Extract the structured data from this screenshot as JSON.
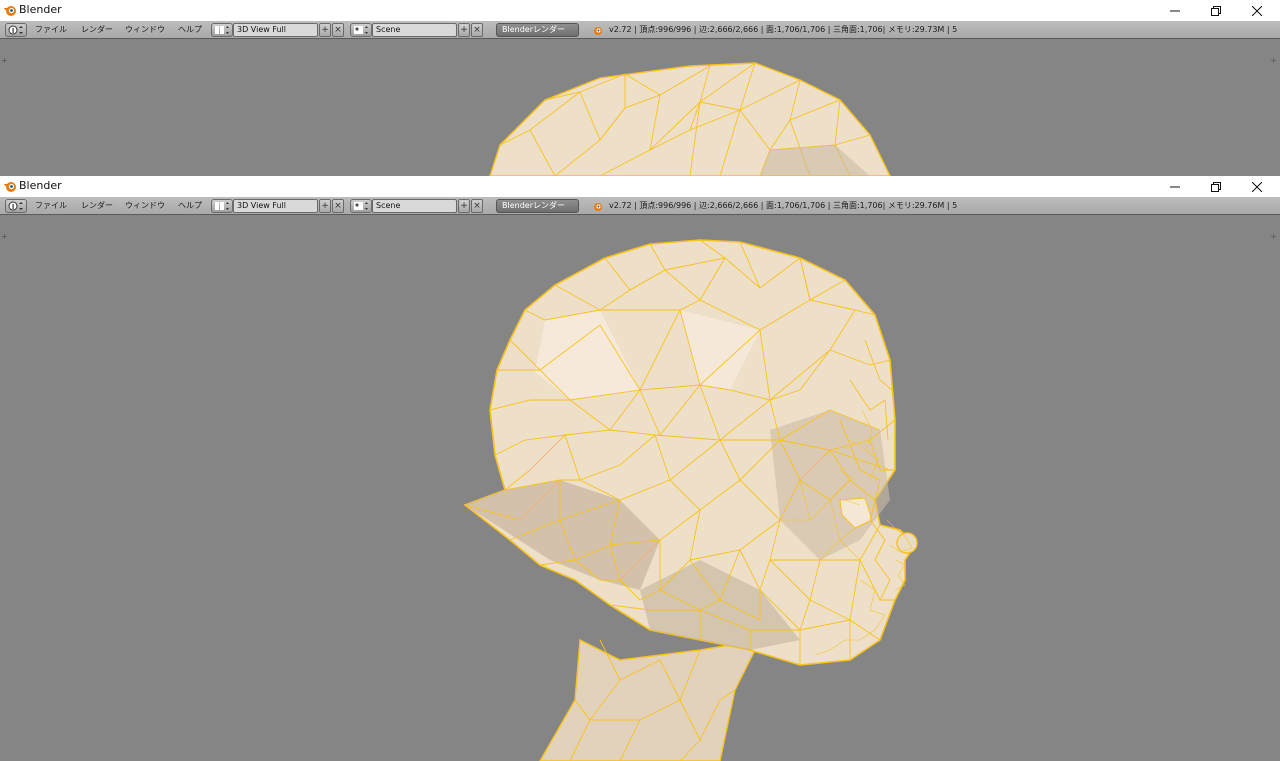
{
  "app": {
    "title": "Blender"
  },
  "menus": [
    "ファイル",
    "レンダー",
    "ウィンドウ",
    "ヘルプ"
  ],
  "screen_layout": {
    "value": "3D View Full"
  },
  "scene": {
    "value": "Scene"
  },
  "render_engine": {
    "value": "Blenderレンダー"
  },
  "windows": [
    {
      "stats": "v2.72 | 頂点:996/996 | 辺:2,666/2,666 | 面:1,706/1,706 | 三角面:1,706| メモリ:29.73M | 5"
    },
    {
      "stats": "v2.72 | 頂点:996/996 | 辺:2,666/2,666 | 面:1,706/1,706 | 三角面:1,706| メモリ:29.76M | 5"
    }
  ],
  "colors": {
    "viewport_bg": "#858585",
    "mesh_fill": "#eedfc9",
    "wire_selected": "#f7c21c"
  },
  "icons": {
    "app_logo": "blender-logo-icon",
    "editor_type": "info-editor-icon",
    "layout": "screen-layout-icon",
    "scene": "scene-icon",
    "render_info": "blender-status-icon"
  }
}
